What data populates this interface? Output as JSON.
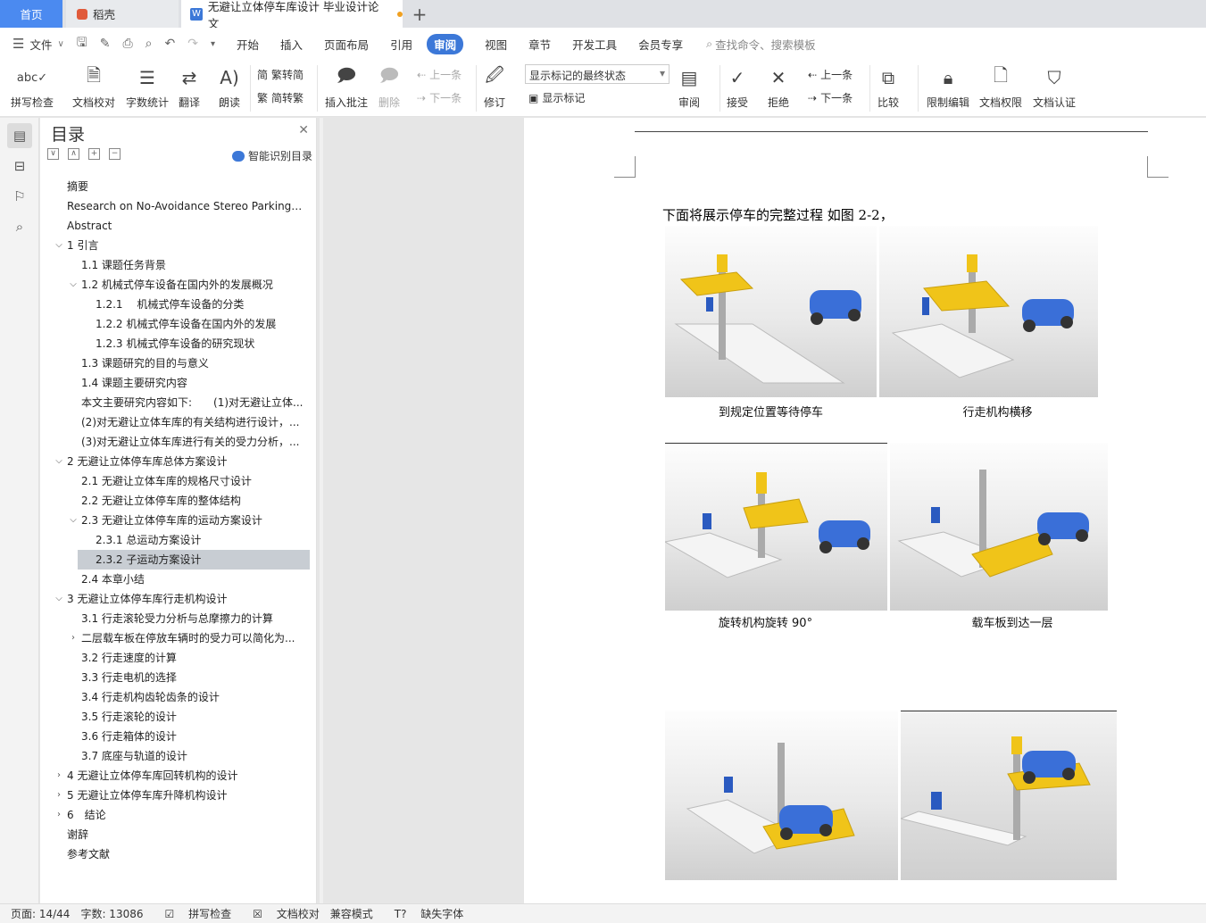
{
  "tabs": {
    "home": "首页",
    "daoke": "稻壳",
    "doc": "无避让立体停车库设计 毕业设计论文",
    "add": "+"
  },
  "menu": {
    "file": "文件",
    "items": [
      "开始",
      "插入",
      "页面布局",
      "引用",
      "审阅",
      "视图",
      "章节",
      "开发工具",
      "会员专享"
    ],
    "search": "查找命令、搜索模板"
  },
  "ribbon": {
    "spell": "拼写检查",
    "proof": "文档校对",
    "count": "字数统计",
    "translate": "翻译",
    "read": "朗读",
    "trad": "繁转简",
    "simp": "简转繁",
    "insert_comment": "插入批注",
    "delete": "删除",
    "prev": "上一条",
    "next": "下一条",
    "revise": "修订",
    "markup_state": "显示标记的最终状态",
    "show_markup": "显示标记",
    "review": "审阅",
    "accept": "接受",
    "reject": "拒绝",
    "prev2": "上一条",
    "next2": "下一条",
    "compare": "比较",
    "restrict": "限制编辑",
    "rights": "文档权限",
    "cert": "文档认证"
  },
  "toc": {
    "title": "目录",
    "smart": "智能识别目录",
    "items": [
      {
        "t": "摘要",
        "i": 0,
        "c": ""
      },
      {
        "t": "Research on No-Avoidance Stereo Parking ...",
        "i": 0,
        "c": ""
      },
      {
        "t": "Abstract",
        "i": 0,
        "c": ""
      },
      {
        "t": "1 引言",
        "i": 0,
        "c": "v"
      },
      {
        "t": "1.1 课题任务背景",
        "i": 1,
        "c": ""
      },
      {
        "t": "1.2 机械式停车设备在国内外的发展概况",
        "i": 1,
        "c": "v"
      },
      {
        "t": "1.2.1　 机械式停车设备的分类",
        "i": 2,
        "c": ""
      },
      {
        "t": "1.2.2  机械式停车设备在国内外的发展",
        "i": 2,
        "c": ""
      },
      {
        "t": "1.2.3 机械式停车设备的研究现状",
        "i": 2,
        "c": ""
      },
      {
        "t": "1.3 课题研究的目的与意义",
        "i": 1,
        "c": ""
      },
      {
        "t": "1.4 课题主要研究内容",
        "i": 1,
        "c": ""
      },
      {
        "t": "本文主要研究内容如下:　　(1)对无避让立体...",
        "i": 1,
        "c": ""
      },
      {
        "t": "(2)对无避让立体车库的有关结构进行设计，...",
        "i": 1,
        "c": ""
      },
      {
        "t": "(3)对无避让立体车库进行有关的受力分析，...",
        "i": 1,
        "c": ""
      },
      {
        "t": "2  无避让立体停车库总体方案设计",
        "i": 0,
        "c": "v"
      },
      {
        "t": "2.1 无避让立体车库的规格尺寸设计",
        "i": 1,
        "c": ""
      },
      {
        "t": "2.2 无避让立体停车库的整体结构",
        "i": 1,
        "c": ""
      },
      {
        "t": "2.3 无避让立体停车库的运动方案设计",
        "i": 1,
        "c": "v"
      },
      {
        "t": "2.3.1 总运动方案设计",
        "i": 2,
        "c": ""
      },
      {
        "t": "2.3.2 子运动方案设计",
        "i": 2,
        "c": "",
        "sel": true
      },
      {
        "t": "2.4 本章小结",
        "i": 1,
        "c": ""
      },
      {
        "t": "3 无避让立体停车库行走机构设计",
        "i": 0,
        "c": "v"
      },
      {
        "t": "3.1 行走滚轮受力分析与总摩擦力的计算",
        "i": 1,
        "c": ""
      },
      {
        "t": "二层载车板在停放车辆时的受力可以简化为...",
        "i": 1,
        "c": ">"
      },
      {
        "t": "3.2 行走速度的计算",
        "i": 1,
        "c": ""
      },
      {
        "t": "3.3 行走电机的选择",
        "i": 1,
        "c": ""
      },
      {
        "t": "3.4 行走机构齿轮齿条的设计",
        "i": 1,
        "c": ""
      },
      {
        "t": "3.5 行走滚轮的设计",
        "i": 1,
        "c": ""
      },
      {
        "t": "3.6 行走箱体的设计",
        "i": 1,
        "c": ""
      },
      {
        "t": "3.7 底座与轨道的设计",
        "i": 1,
        "c": ""
      },
      {
        "t": "4 无避让立体停车库回转机构的设计",
        "i": 0,
        "c": ">"
      },
      {
        "t": "5 无避让立体停车库升降机构设计",
        "i": 0,
        "c": ">"
      },
      {
        "t": "6　结论",
        "i": 0,
        "c": ">"
      },
      {
        "t": "谢辞",
        "i": 0,
        "c": ""
      },
      {
        "t": "参考文献",
        "i": 0,
        "c": ""
      }
    ]
  },
  "doc": {
    "intro": "下面将展示停车的完整过程 如图 2-2，",
    "captions": [
      "到规定位置等待停车",
      "行走机构横移",
      "旋转机构旋转 90°",
      "载车板到达一层"
    ]
  },
  "status": {
    "page": "页面: 14/44",
    "words": "字数: 13086",
    "spell": "拼写检查",
    "proof": "文档校对",
    "compat": "兼容模式",
    "font": "缺失字体"
  },
  "colors": {
    "accent": "#3c78d8",
    "car": "#3a6fd8",
    "plate": "#f0c419"
  }
}
